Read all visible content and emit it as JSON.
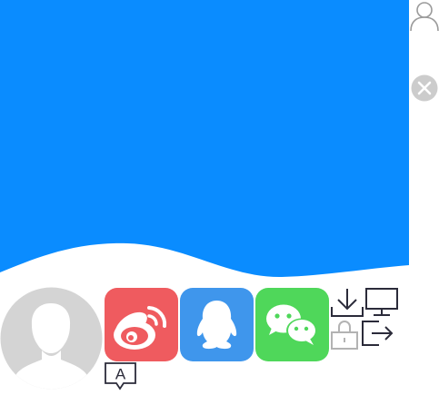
{
  "colors": {
    "banner_blue": "#0a8cff",
    "weibo_bg": "#ef5b5f",
    "qq_bg": "#3f96ec",
    "wechat_bg": "#4fd75a",
    "avatar_gray": "#d4d4d4",
    "icon_dark": "#2b2b3a",
    "icon_gray": "#b3b3b3"
  },
  "icons": {
    "user": "user-outline-icon",
    "close": "close-circle-icon",
    "avatar": "default-avatar-icon",
    "weibo": "weibo-icon",
    "qq": "qq-penguin-icon",
    "wechat": "wechat-icon",
    "download": "download-icon",
    "monitor": "monitor-icon",
    "lock": "lock-icon",
    "logout": "logout-icon",
    "font": "font-a-icon"
  },
  "font_button": {
    "letter": "A"
  }
}
